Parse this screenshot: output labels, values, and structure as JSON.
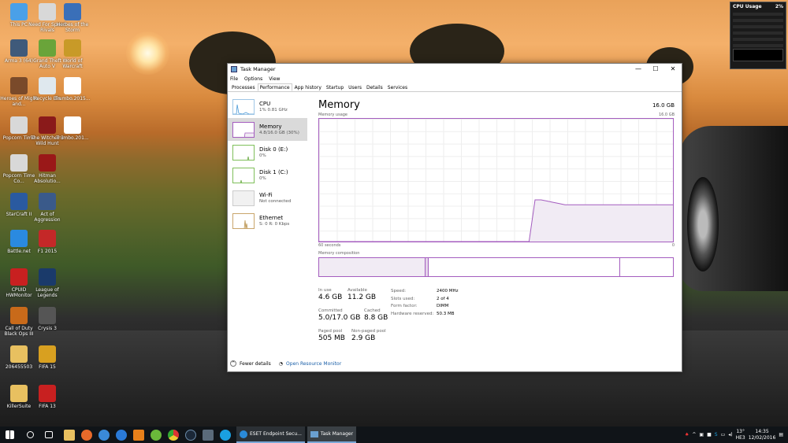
{
  "desktop_icons": [
    {
      "label": "This PC",
      "icon": "this-pc-icon",
      "color": "#4aa0e8"
    },
    {
      "label": "Need For Speed Rivals",
      "icon": "need-for-speed-icon",
      "color": "#d8d8d8"
    },
    {
      "label": "Heroes of the Storm",
      "icon": "heroes-storm-icon",
      "color": "#3a6fb8"
    },
    {
      "label": "Arma 3 (64)",
      "icon": "arma3-icon",
      "color": "#3f5a7a"
    },
    {
      "label": "Grand Theft Auto V",
      "icon": "gta-icon",
      "color": "#6aa43a"
    },
    {
      "label": "World of Warcraft",
      "icon": "wow-icon",
      "color": "#c89a28"
    },
    {
      "label": "Heroes of Might and...",
      "icon": "heroes-might-icon",
      "color": "#7a4a2a"
    },
    {
      "label": "Recycle Bin",
      "icon": "recycle-bin-icon",
      "color": "#dfe8ee"
    },
    {
      "label": "Trumbo.2015...",
      "icon": "file-icon",
      "color": "#ffffff"
    },
    {
      "label": "Popcorn Time",
      "icon": "popcorn-icon",
      "color": "#d8d8d8"
    },
    {
      "label": "The Witcher 3 Wild Hunt",
      "icon": "witcher-icon",
      "color": "#8a1a1a"
    },
    {
      "label": "Trumbo.201...",
      "icon": "file-icon",
      "color": "#ffffff"
    },
    {
      "label": "Popcorn Time Co...",
      "icon": "popcorn-icon",
      "color": "#d8d8d8"
    },
    {
      "label": "Hitman Absolutio...",
      "icon": "hitman-icon",
      "color": "#9a1818"
    },
    {
      "label": "StarCraft II",
      "icon": "starcraft-icon",
      "color": "#2a5aa0"
    },
    {
      "label": "Act of Aggression",
      "icon": "act-aggression-icon",
      "color": "#3a5a8a"
    },
    {
      "label": "Battle.net",
      "icon": "battlenet-icon",
      "color": "#2a8ae0"
    },
    {
      "label": "F1 2015",
      "icon": "f1-icon",
      "color": "#c42828"
    },
    {
      "label": "CPUID HWMonitor",
      "icon": "hwmonitor-icon",
      "color": "#c82020"
    },
    {
      "label": "League of Legends",
      "icon": "lol-icon",
      "color": "#1a3a6a"
    },
    {
      "label": "Call of Duty Black Ops III",
      "icon": "cod-icon",
      "color": "#c86a1a"
    },
    {
      "label": "Crysis 3",
      "icon": "crysis-icon",
      "color": "#555555"
    },
    {
      "label": "206455503",
      "icon": "folder-icon",
      "color": "#e8c060"
    },
    {
      "label": "FIFA 15",
      "icon": "fifa15-icon",
      "color": "#d8a020"
    },
    {
      "label": "KillerSuite",
      "icon": "folder-icon",
      "color": "#e8c060"
    },
    {
      "label": "FIFA 13",
      "icon": "fifa13-icon",
      "color": "#c82020"
    }
  ],
  "widget": {
    "title": "CPU Usage",
    "percent": "2%"
  },
  "task_manager": {
    "title": "Task Manager",
    "controls": {
      "minimize": "—",
      "maximize": "☐",
      "close": "✕"
    },
    "menu": [
      "File",
      "Options",
      "View"
    ],
    "tabs": [
      "Processes",
      "Performance",
      "App history",
      "Startup",
      "Users",
      "Details",
      "Services"
    ],
    "active_tab": "Performance",
    "side_items": [
      {
        "name": "CPU",
        "detail": "1% 0.81 GHz"
      },
      {
        "name": "Memory",
        "detail": "4.8/16.0 GB (30%)"
      },
      {
        "name": "Disk 0 (E:)",
        "detail": "0%"
      },
      {
        "name": "Disk 1 (C:)",
        "detail": "0%"
      },
      {
        "name": "Wi-Fi",
        "detail": "Not connected"
      },
      {
        "name": "Ethernet",
        "detail": "S: 0 R: 0 Kbps"
      }
    ],
    "memory": {
      "title": "Memory",
      "total": "16.0 GB",
      "usage_label": "Memory usage",
      "usage_max": "16.0 GB",
      "time_label": "60 seconds",
      "zero_label": "0",
      "composition_label": "Memory composition",
      "stats": {
        "in_use_label": "In use",
        "in_use": "4.6 GB",
        "available_label": "Available",
        "available": "11.2 GB",
        "committed_label": "Committed",
        "committed": "5.0/17.0 GB",
        "cached_label": "Cached",
        "cached": "8.8 GB",
        "paged_label": "Paged pool",
        "paged": "505 MB",
        "nonpaged_label": "Non-paged pool",
        "nonpaged": "2.9 GB"
      },
      "details": [
        {
          "k": "Speed:",
          "v": "2400 MHz"
        },
        {
          "k": "Slots used:",
          "v": "2 of 4"
        },
        {
          "k": "Form factor:",
          "v": "DIMM"
        },
        {
          "k": "Hardware reserved:",
          "v": "50.3 MB"
        }
      ],
      "usage_fraction_series": [
        0,
        0,
        0,
        0,
        0,
        0,
        0,
        0,
        0,
        0,
        0,
        0,
        0,
        0,
        0,
        0,
        0,
        0,
        0,
        0,
        0,
        0,
        0,
        0,
        0,
        0,
        0,
        0,
        0,
        0,
        0,
        0,
        0,
        0,
        0,
        0,
        0.34,
        0.34,
        0.33,
        0.32,
        0.31,
        0.3,
        0.3,
        0.3,
        0.3,
        0.3,
        0.3,
        0.3,
        0.3,
        0.3,
        0.3,
        0.3,
        0.3,
        0.3,
        0.3,
        0.3,
        0.3,
        0.3,
        0.3,
        0.3
      ]
    },
    "footer": {
      "fewer": "Fewer details",
      "monitor": "Open Resource Monitor"
    }
  },
  "taskbar": {
    "apps": [
      {
        "label": "ESET Endpoint Secu..."
      },
      {
        "label": "Task Manager"
      }
    ],
    "time": "14:35",
    "date": "12/02/2016",
    "lang": "HE3",
    "temp": "13°"
  },
  "colors": {
    "memory": "#a45dbf",
    "memory_fill": "#f1ebf4",
    "accent": "#7aa7d6"
  }
}
